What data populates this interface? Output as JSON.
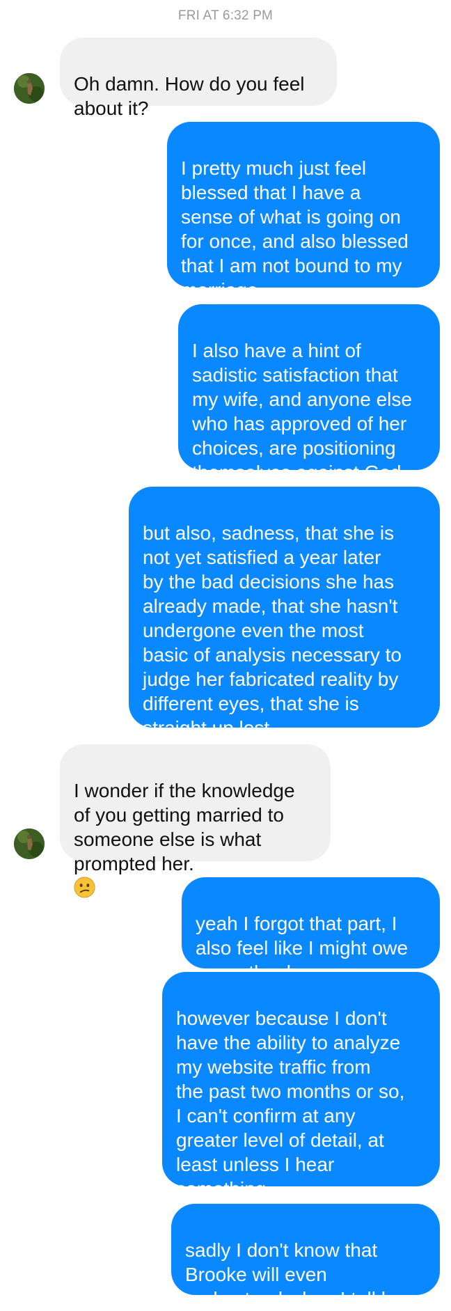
{
  "thread": {
    "timestamp": "FRI AT 6:32 PM",
    "messages": [
      {
        "sender": "them",
        "text": "Oh damn. How do you feel\nabout it?"
      },
      {
        "sender": "me",
        "text": "I pretty much just feel\nblessed that I have a\nsense of what is going on\nfor once, and also blessed\nthat I am not bound to my\nmarriage"
      },
      {
        "sender": "me",
        "text": "I also have a hint of\nsadistic satisfaction that\nmy wife, and anyone else\nwho has approved of her\nchoices, are positioning\nthemselves against God"
      },
      {
        "sender": "me",
        "text": "but also, sadness, that she is\nnot yet satisfied a year later\nby the bad decisions she has\nalready made, that she hasn't\nundergone even the most\nbasic of analysis necessary to\njudge her fabricated reality by\ndifferent eyes, that she is\nstraight up lost"
      },
      {
        "sender": "them",
        "text": "I wonder if the knowledge\nof you getting married to\nsomeone else is what\nprompted her.",
        "emoji": "confused-face"
      },
      {
        "sender": "me",
        "text": "yeah I forgot that part, I\nalso feel like I might owe\nyou a thank you"
      },
      {
        "sender": "me",
        "text": "however because I don't\nhave the ability to analyze\nmy website traffic from\nthe past two months or so,\nI can't confirm at any\ngreater level of detail, at\nleast unless I hear\nsomething"
      },
      {
        "sender": "me",
        "text": "sadly I don't know that\nBrooke will even\nunderstand when I tell her"
      }
    ]
  },
  "colors": {
    "outgoing_bubble": "#0a88ff",
    "incoming_bubble": "#f0f0f0",
    "timestamp": "#9a9a9a"
  }
}
